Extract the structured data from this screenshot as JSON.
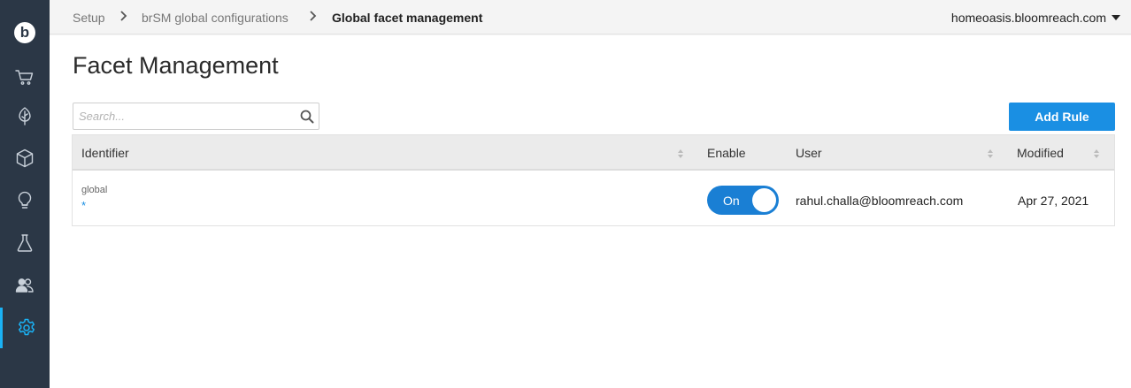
{
  "breadcrumb": {
    "items": [
      "Setup",
      "brSM global configurations"
    ],
    "current": "Global facet management"
  },
  "account": {
    "domain": "homeoasis.bloomreach.com"
  },
  "sidebar": {
    "logo": "b",
    "items": [
      {
        "icon": "cart-icon"
      },
      {
        "icon": "leaf-icon"
      },
      {
        "icon": "cube-icon"
      },
      {
        "icon": "lightbulb-icon"
      },
      {
        "icon": "flask-icon"
      },
      {
        "icon": "users-icon"
      },
      {
        "icon": "gear-icon",
        "active": true
      }
    ]
  },
  "page": {
    "title": "Facet Management"
  },
  "search": {
    "placeholder": "Search...",
    "value": ""
  },
  "toolbar": {
    "add_rule_label": "Add Rule"
  },
  "table": {
    "columns": [
      "Identifier",
      "Enable",
      "User",
      "Modified"
    ],
    "rows": [
      {
        "identifier": "global",
        "identifier_sub": "*",
        "enable_label": "On",
        "user": "rahul.challa@bloomreach.com",
        "modified": "Apr 27, 2021"
      }
    ]
  },
  "colors": {
    "sidebar": "#2b3746",
    "accent": "#1ab2f5",
    "primary_button": "#1a8fe3",
    "toggle_on": "#1a7fd4"
  }
}
